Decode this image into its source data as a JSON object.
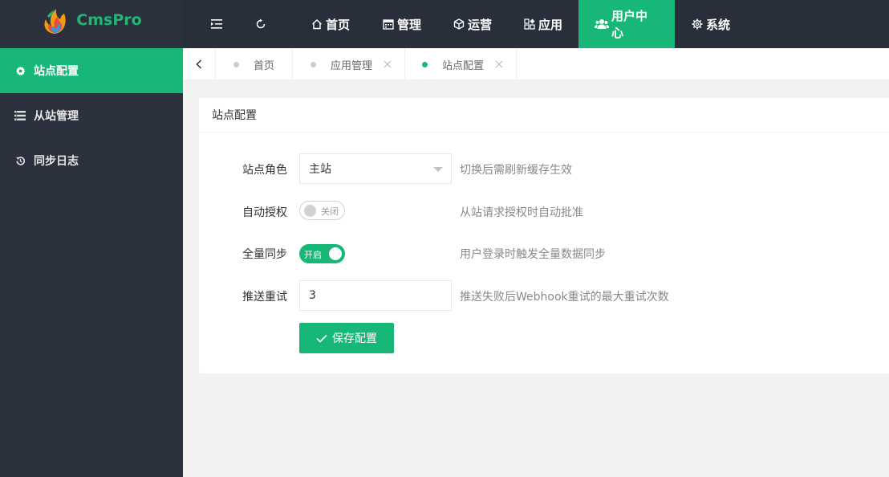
{
  "app": {
    "brand": "CmsPro"
  },
  "header": {
    "icons": {
      "collapse": "indent-icon",
      "refresh": "refresh-icon"
    },
    "nav": [
      {
        "label": "首页",
        "icon": "home-icon"
      },
      {
        "label": "管理",
        "icon": "calendar-icon"
      },
      {
        "label": "运营",
        "icon": "cube-icon"
      },
      {
        "label": "应用",
        "icon": "apps-icon"
      },
      {
        "label": "用户中心",
        "icon": "users-icon",
        "active": true
      },
      {
        "label": "系统",
        "icon": "gear-icon"
      }
    ]
  },
  "sidebar": {
    "items": [
      {
        "label": "站点配置",
        "icon": "gear-icon",
        "active": true
      },
      {
        "label": "从站管理",
        "icon": "list-icon"
      },
      {
        "label": "同步日志",
        "icon": "history-icon"
      }
    ]
  },
  "tabs": [
    {
      "label": "首页",
      "closable": false
    },
    {
      "label": "应用管理",
      "closable": true
    },
    {
      "label": "站点配置",
      "closable": true,
      "active": true
    }
  ],
  "form": {
    "title": "站点配置",
    "site_role": {
      "label": "站点角色",
      "value": "主站",
      "tip": "切换后需刷新缓存生效"
    },
    "auto_auth": {
      "label": "自动授权",
      "state": "关闭",
      "on": false,
      "tip": "从站请求授权时自动批准"
    },
    "full_sync": {
      "label": "全量同步",
      "state": "开启",
      "on": true,
      "tip": "用户登录时触发全量数据同步"
    },
    "retry": {
      "label": "推送重试",
      "value": "3",
      "tip": "推送失败后Webhook重试的最大重试次数"
    },
    "save_label": "保存配置"
  },
  "colors": {
    "accent": "#16b777",
    "dark": "#282f3a"
  }
}
